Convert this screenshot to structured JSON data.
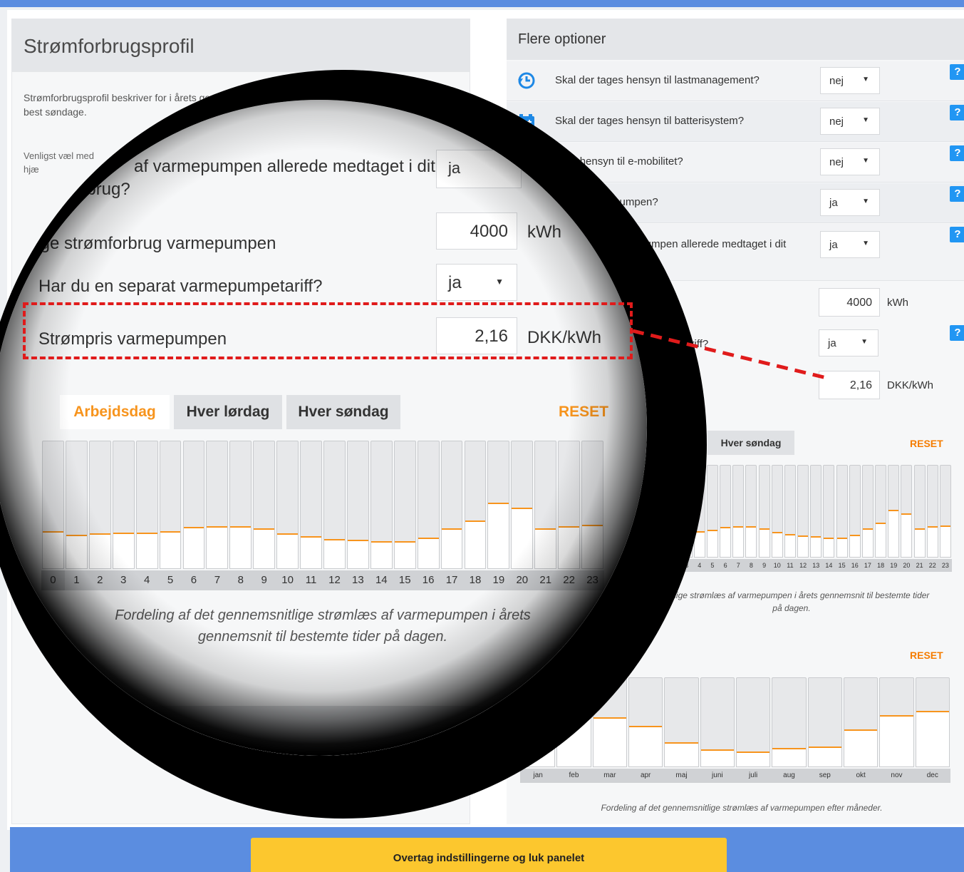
{
  "left_panel": {
    "title": "Strømforbrugsprofil",
    "description": "Strømforbrugsprofil beskriver for i årets gennemsnit til best søndage.",
    "question": "Venligst væl med hjæ"
  },
  "right_panel": {
    "title": "Flere optioner",
    "options": [
      {
        "label": "Skal der tages hensyn til lastmanagement?",
        "value": "nej",
        "icon": "clock-history-icon"
      },
      {
        "label": "Skal der tages hensyn til batterisystem?",
        "value": "nej",
        "icon": "battery-icon"
      },
      {
        "label": "Tage hensyn til e-mobilitet?",
        "value": "nej",
        "icon": "car-icon"
      },
      {
        "label": "syn til varmepumpen?",
        "value": "ja",
        "icon": ""
      },
      {
        "label": "epumpen allerede medtaget i dit",
        "value": "ja",
        "icon": ""
      }
    ],
    "annual_label": "umpen",
    "annual_value": "4000",
    "annual_unit": "kWh",
    "tariff_label": "tariff?",
    "tariff_value": "ja",
    "price_value": "2,16",
    "price_unit": "DKK/kWh",
    "tab_sunday": "Hver søndag",
    "reset": "RESET",
    "daily_caption": "msnitlige strømlæs af varmepumpen i årets gennemsnit til bestemte tider på dagen.",
    "monthly_caption": "Fordeling af det gennemsnitlige strømlæs af varmepumpen efter måneder."
  },
  "magnifier": {
    "question": "af varmepumpen allerede medtaget i dit",
    "question2": "orbrug?",
    "question_value": "ja",
    "annual_label": "rlige strømforbrug varmepumpen",
    "annual_value": "4000",
    "annual_unit": "kWh",
    "tariff_label": "Har du en separat varmepumpetariff?",
    "tariff_value": "ja",
    "price_label": "Strømpris varmepumpen",
    "price_value": "2,16",
    "price_unit": "DKK/kWh",
    "tabs": [
      "Arbejdsdag",
      "Hver lørdag",
      "Hver søndag"
    ],
    "reset": "RESET",
    "caption": "Fordeling af det gennemsnitlige strømlæs af varmepumpen i årets gennemsnit til bestemte tider på dagen."
  },
  "cta_label": "Overtag indstillingerne og luk panelet",
  "chart_data": [
    {
      "type": "bar",
      "title": "",
      "categories": [
        "0",
        "1",
        "2",
        "3",
        "4",
        "5",
        "6",
        "7",
        "8",
        "9",
        "10",
        "11",
        "12",
        "13",
        "14",
        "15",
        "16",
        "17",
        "18",
        "19",
        "20",
        "21",
        "22",
        "23"
      ],
      "values": [
        0.29,
        0.26,
        0.27,
        0.28,
        0.28,
        0.29,
        0.32,
        0.33,
        0.33,
        0.31,
        0.27,
        0.25,
        0.23,
        0.22,
        0.21,
        0.21,
        0.24,
        0.31,
        0.37,
        0.51,
        0.47,
        0.31,
        0.33,
        0.34
      ],
      "ylim": [
        0,
        1
      ]
    },
    {
      "type": "bar",
      "title": "",
      "categories": [
        "jan",
        "feb",
        "mar",
        "apr",
        "maj",
        "juni",
        "juli",
        "aug",
        "sep",
        "okt",
        "nov",
        "dec"
      ],
      "values": [
        0.62,
        0.6,
        0.55,
        0.45,
        0.27,
        0.19,
        0.17,
        0.21,
        0.22,
        0.41,
        0.57,
        0.62
      ],
      "ylim": [
        0,
        1
      ]
    }
  ]
}
